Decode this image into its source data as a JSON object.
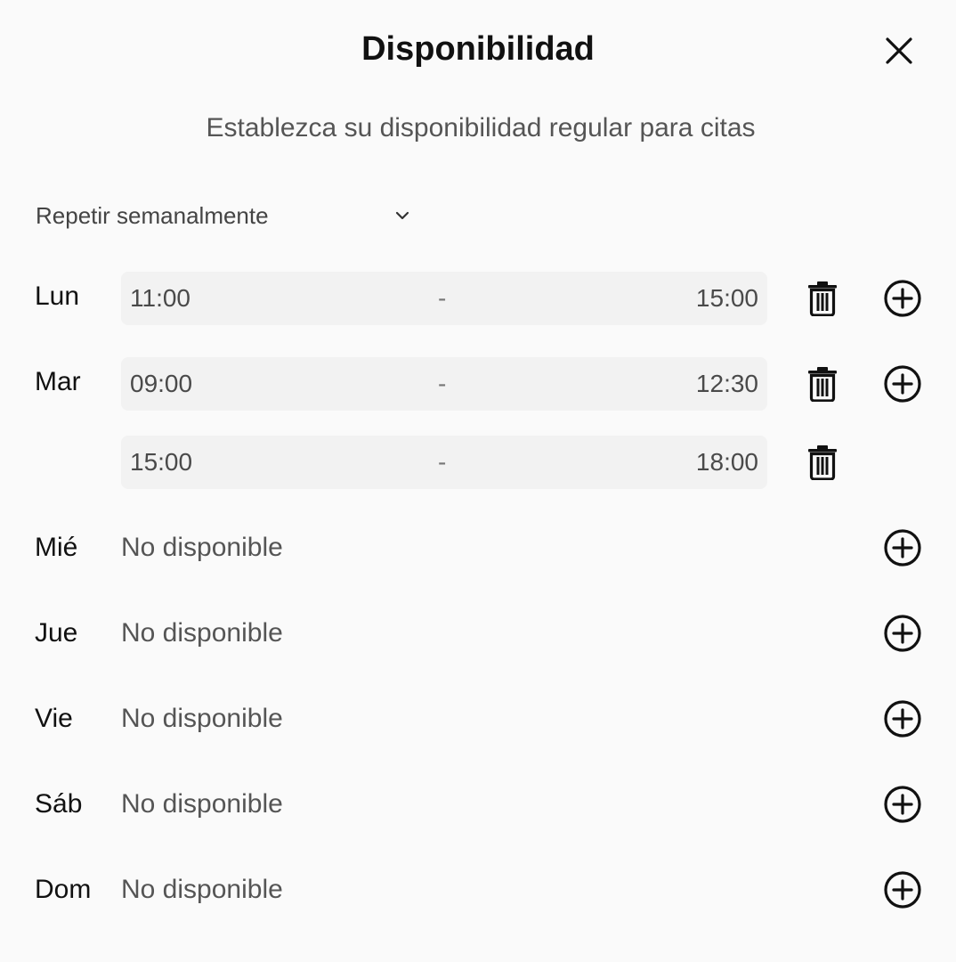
{
  "dialog": {
    "title": "Disponibilidad",
    "subtitle": "Establezca su disponibilidad regular para citas"
  },
  "repeat": {
    "selected": "Repetir semanalmente"
  },
  "days": [
    {
      "label": "Lun",
      "slots": [
        {
          "start": "11:00",
          "separator": "-",
          "end": "15:00"
        }
      ]
    },
    {
      "label": "Mar",
      "slots": [
        {
          "start": "09:00",
          "separator": "-",
          "end": "12:30"
        },
        {
          "start": "15:00",
          "separator": "-",
          "end": "18:00"
        }
      ]
    },
    {
      "label": "Mié",
      "status": "No disponible"
    },
    {
      "label": "Jue",
      "status": "No disponible"
    },
    {
      "label": "Vie",
      "status": "No disponible"
    },
    {
      "label": "Sáb",
      "status": "No disponible"
    },
    {
      "label": "Dom",
      "status": "No disponible"
    }
  ],
  "icons": {
    "close": "close-icon",
    "chevron": "chevron-down-icon",
    "delete": "trash-icon",
    "add": "plus-circle-icon"
  },
  "colors": {
    "background": "#fafafa",
    "slot_background": "#f2f2f2",
    "text_primary": "#111111",
    "text_secondary": "#555555"
  }
}
